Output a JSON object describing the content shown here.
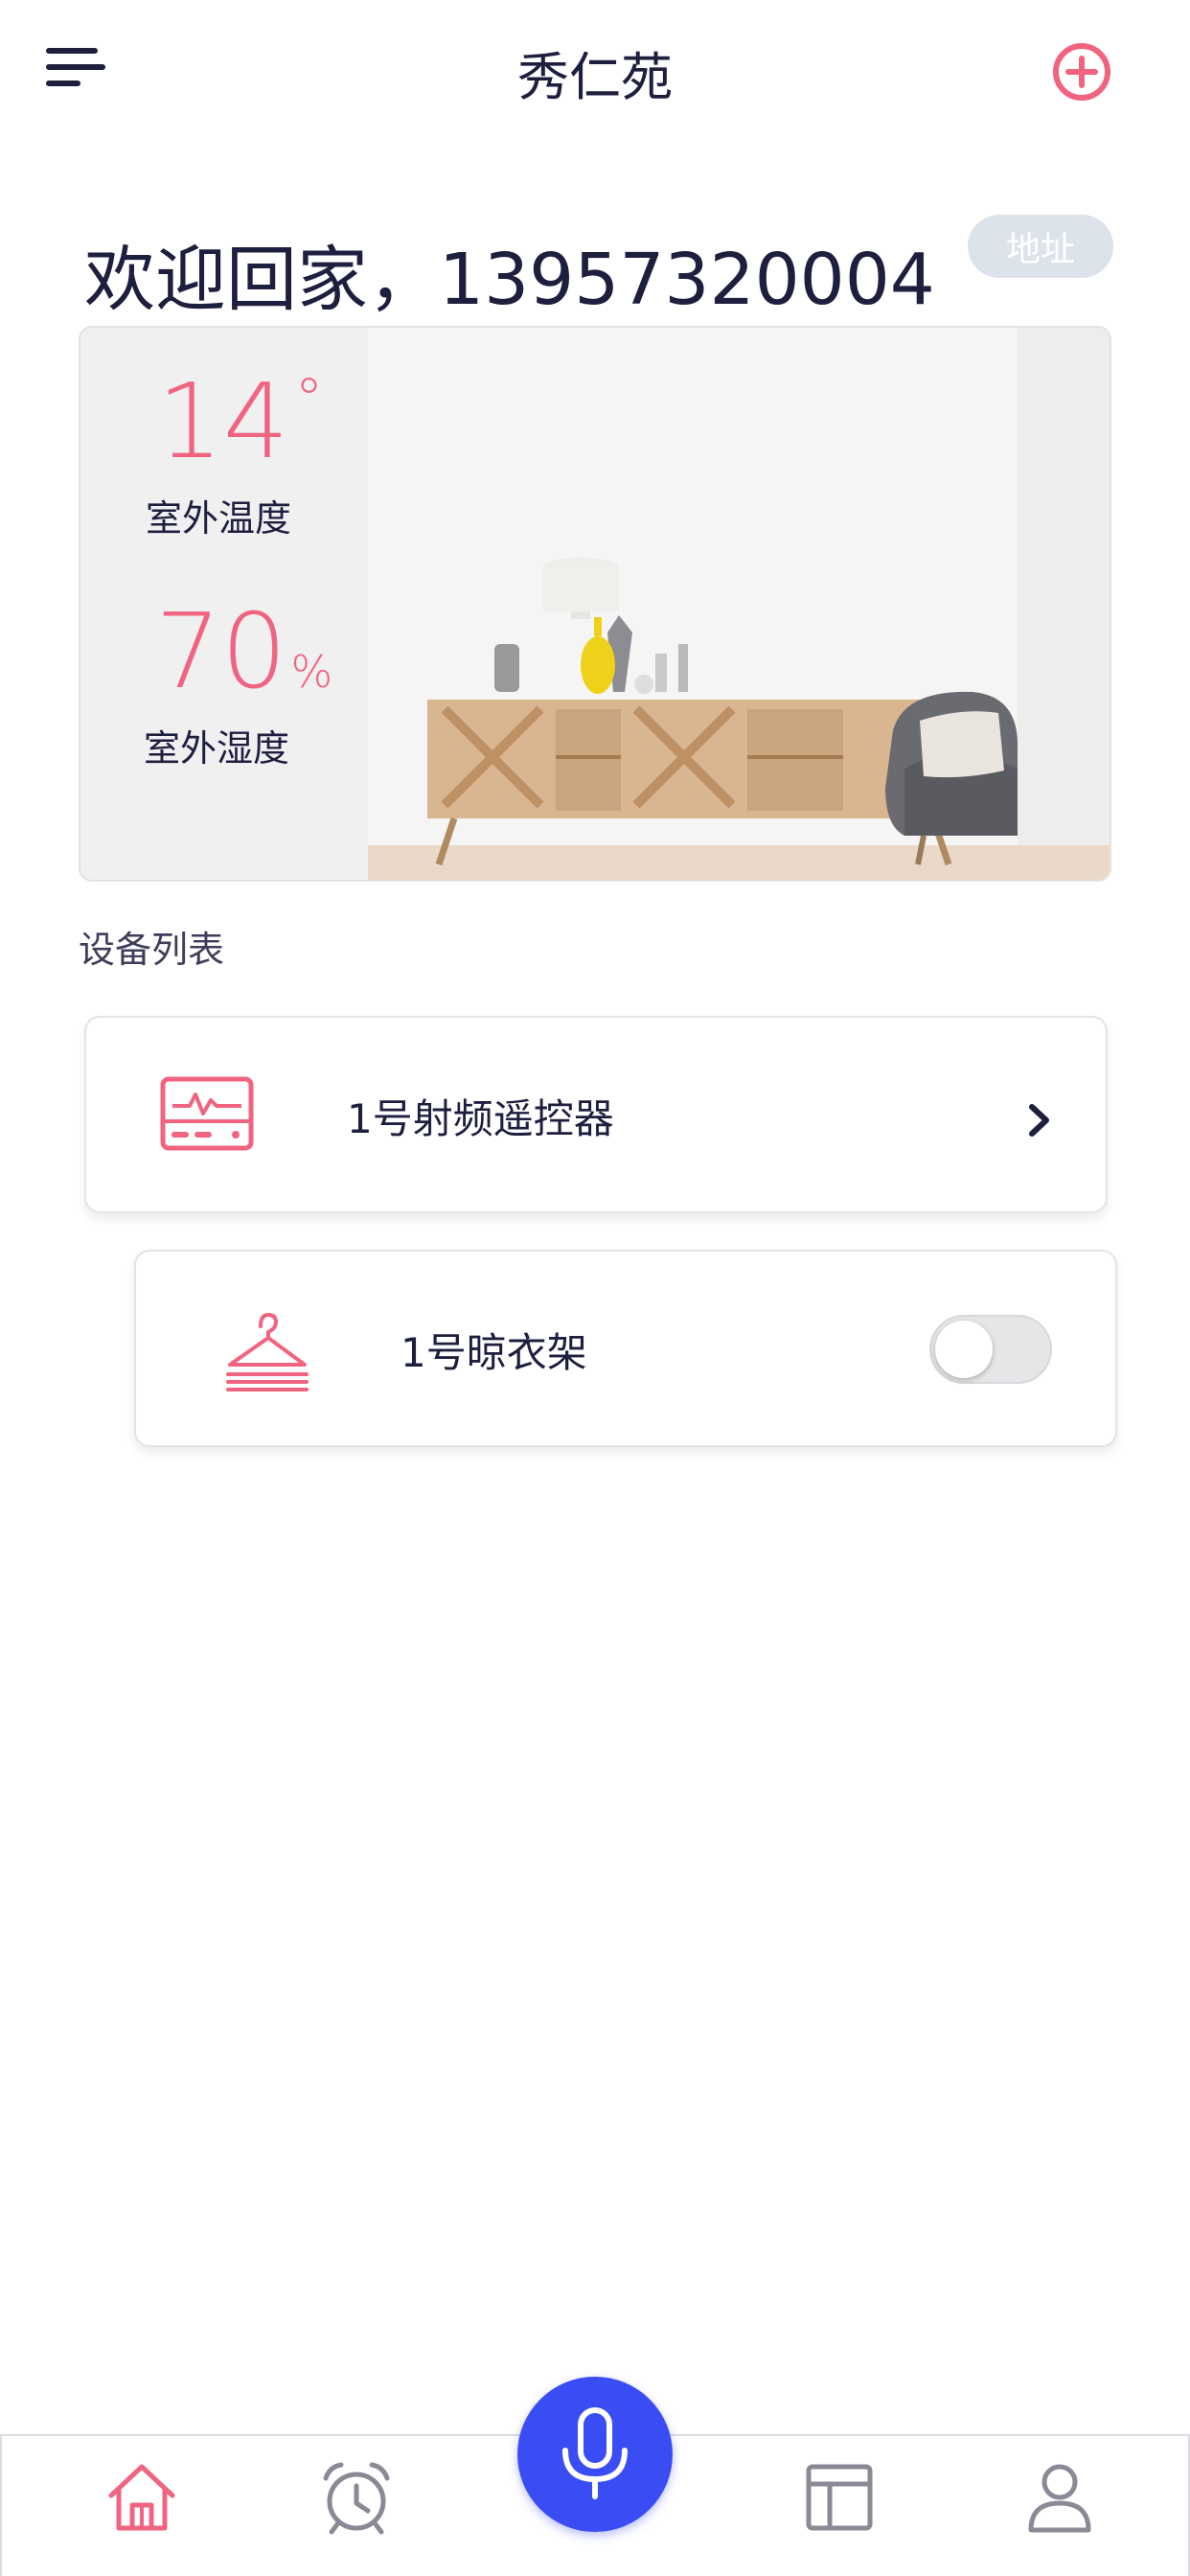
{
  "header": {
    "title": "秀仁苑",
    "menu_icon": "menu-icon",
    "add_icon": "plus-circle-icon"
  },
  "welcome": {
    "text": "欢迎回家，13957320004",
    "address_badge": "地址"
  },
  "weather": {
    "temperature": "14",
    "temperature_unit": "°",
    "temperature_label": "室外温度",
    "humidity": "70",
    "humidity_unit": "%",
    "humidity_label": "室外湿度"
  },
  "devices": {
    "section_label": "设备列表",
    "items": [
      {
        "name": "1号射频遥控器",
        "icon": "rf-remote-icon",
        "action": "chevron-right-icon"
      },
      {
        "name": "1号晾衣架",
        "icon": "clothes-hanger-icon",
        "toggle_on": false
      }
    ]
  },
  "tabbar": {
    "tabs": [
      {
        "icon": "home-icon",
        "active": true
      },
      {
        "icon": "alarm-clock-icon",
        "active": false
      },
      {
        "icon": "microphone-icon",
        "active": false
      },
      {
        "icon": "layout-icon",
        "active": false
      },
      {
        "icon": "user-icon",
        "active": false
      }
    ]
  },
  "colors": {
    "accent": "#f06480",
    "text": "#1e1e3f",
    "mic": "#3a4df5",
    "badge_bg": "#dde3ea",
    "inactive_icon": "#8a8a96"
  }
}
